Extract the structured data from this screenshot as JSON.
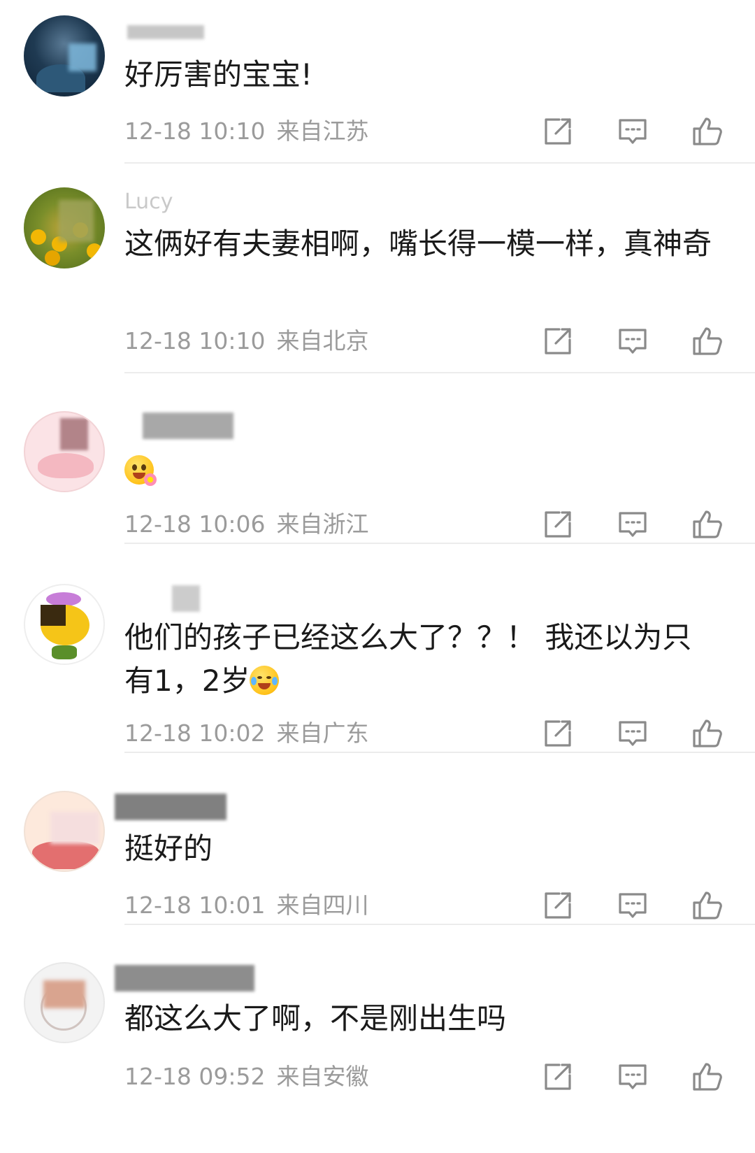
{
  "comments": [
    {
      "username": "",
      "text": "好厉害的宝宝!",
      "emoji": "",
      "time": "12-18 10:10",
      "location": "来自江苏",
      "avatar_colors": [
        "#0e2236",
        "#7ab3d6"
      ]
    },
    {
      "username": "Lucy",
      "text": "这俩好有夫妻相啊，嘴长得一模一样，真神奇",
      "emoji": "",
      "time": "12-18 10:10",
      "location": "来自北京",
      "avatar_colors": [
        "#6d8a1e",
        "#f2b705"
      ]
    },
    {
      "username": "",
      "text": "",
      "emoji": "flower-smile-emoji",
      "time": "12-18 10:06",
      "location": "来自浙江",
      "avatar_colors": [
        "#fbe3e6",
        "#f4b8c1"
      ]
    },
    {
      "username": "",
      "text": "他们的孩子已经这么大了？？！ 我还以为只有1，2岁",
      "emoji": "laughing-tears-emoji",
      "time": "12-18 10:02",
      "location": "来自广东",
      "avatar_colors": [
        "#ffffff",
        "#f5c518"
      ]
    },
    {
      "username": "",
      "text": "挺好的",
      "emoji": "",
      "time": "12-18 10:01",
      "location": "来自四川",
      "avatar_colors": [
        "#fde9dc",
        "#e36f6f"
      ]
    },
    {
      "username": "",
      "text": "都这么大了啊，不是刚出生吗",
      "emoji": "",
      "time": "12-18 09:52",
      "location": "来自安徽",
      "avatar_colors": [
        "#f3f3f3",
        "#d9a48f"
      ]
    }
  ],
  "icons": {
    "share": "share-icon",
    "reply": "comment-icon",
    "like": "thumbs-up-icon"
  },
  "colors": {
    "text": "#1a1a1a",
    "meta": "#9b9b9b",
    "divider": "#ececec",
    "icon": "#8a8a8a"
  }
}
